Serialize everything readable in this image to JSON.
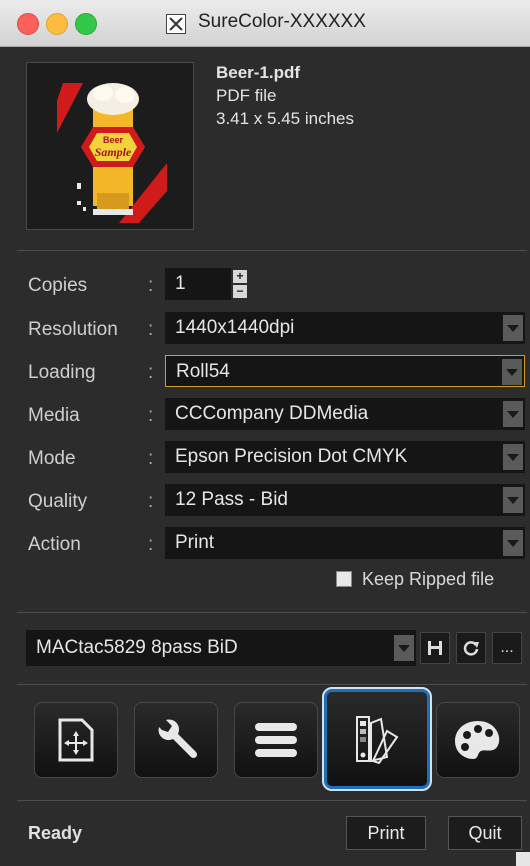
{
  "window": {
    "title": "SureColor-XXXXXX"
  },
  "preview": {
    "badge_top": "Beer",
    "badge_bottom": "Sample"
  },
  "file": {
    "name": "Beer-1.pdf",
    "type": "PDF file",
    "size": "3.41 x 5.45 inches"
  },
  "settings": {
    "copies": {
      "label": "Copies",
      "colon": ":",
      "value": "1"
    },
    "resolution": {
      "label": "Resolution",
      "colon": ":",
      "value": "1440x1440dpi"
    },
    "loading": {
      "label": "Loading",
      "colon": ":",
      "value": "Roll54"
    },
    "media": {
      "label": "Media",
      "colon": ":",
      "value": "CCCompany DDMedia"
    },
    "mode": {
      "label": "Mode",
      "colon": ":",
      "value": "Epson Precision Dot CMYK"
    },
    "quality": {
      "label": "Quality",
      "colon": ":",
      "value": "12 Pass - Bid"
    },
    "action": {
      "label": "Action",
      "colon": ":",
      "value": "Print"
    },
    "keep_ripped": {
      "label": "Keep Ripped file",
      "checked": false
    }
  },
  "preset": {
    "value": "MACtac5829 8pass BiD",
    "more_label": "..."
  },
  "toolbar": {
    "tools": [
      {
        "name": "layout-tool",
        "icon": "move-page-icon"
      },
      {
        "name": "settings-tool",
        "icon": "wrench-icon"
      },
      {
        "name": "queue-tool",
        "icon": "list-icon"
      },
      {
        "name": "color-swatch-tool",
        "icon": "swatch-fan-icon",
        "selected": true
      },
      {
        "name": "color-palette-tool",
        "icon": "palette-icon"
      }
    ],
    "accent": "#1e6fb6"
  },
  "status": {
    "text": "Ready"
  },
  "buttons": {
    "print": "Print",
    "quit": "Quit"
  }
}
